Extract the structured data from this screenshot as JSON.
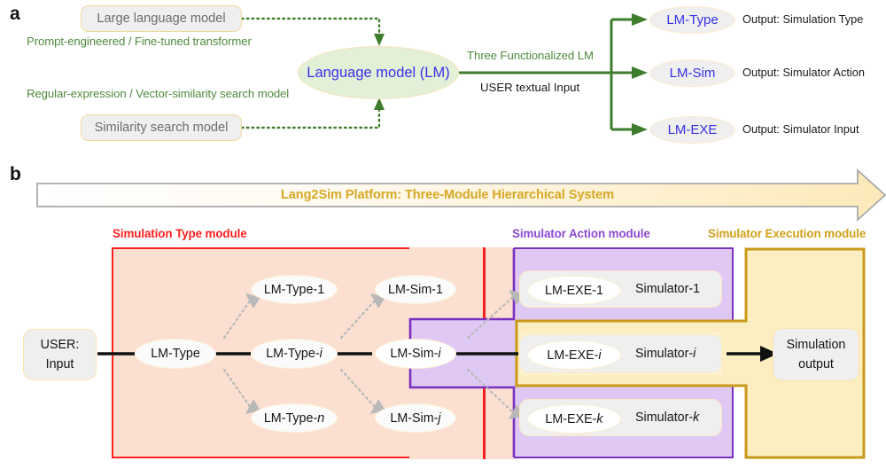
{
  "figure": {
    "panel_a_letter": "a",
    "panel_b_letter": "b"
  },
  "panel_a": {
    "source_boxes": [
      {
        "label": "Large language model"
      },
      {
        "label": "Similarity search model"
      }
    ],
    "annotations": [
      {
        "label": "Prompt-engineered / Fine-tuned transformer",
        "color": "#4f8a3d"
      },
      {
        "label": "Regular-expression / Vector-similarity search model",
        "color": "#4f8a3d"
      }
    ],
    "central_node": {
      "label": "Language model (LM)",
      "fill": "#e3f0d8",
      "text_color": "#3730e8"
    },
    "edge_labels": {
      "above": "Three Functionalized LM",
      "below": "USER textual Input"
    },
    "functionalized": [
      {
        "node": "LM-Type",
        "output": "Output: Simulation Type"
      },
      {
        "node": "LM-Sim",
        "output": "Output: Simulator Action"
      },
      {
        "node": "LM-EXE",
        "output": "Output: Simulator Input"
      }
    ]
  },
  "panel_b": {
    "banner": {
      "label": "Lang2Sim Platform: Three-Module Hierarchical System",
      "text_color": "#d6a824"
    },
    "modules": [
      {
        "name": "Simulation Type module",
        "color": "#ff1f1f",
        "fill": "#fbe0d2"
      },
      {
        "name": "Simulator Action module",
        "color": "#8b4ad0",
        "fill": "#dfc9f4"
      },
      {
        "name": "Simulator Execution module",
        "color": "#d2a017",
        "fill": "#fceec0"
      }
    ],
    "user_input": {
      "line1": "USER:",
      "line2": "Input"
    },
    "type_nodes": {
      "root": "LM-Type",
      "branch_top": "LM-Type-1",
      "branch_mid": "LM-Type-i",
      "branch_bottom": "LM-Type-n"
    },
    "sim_nodes": {
      "top": "LM-Sim-1",
      "mid": "LM-Sim-i",
      "bottom": "LM-Sim-j"
    },
    "exe_rows": [
      {
        "lm": "LM-EXE-1",
        "simulator": "Simulator-1"
      },
      {
        "lm": "LM-EXE-i",
        "simulator": "Simulator-i"
      },
      {
        "lm": "LM-EXE-k",
        "simulator": "Simulator-k"
      }
    ],
    "output_box": {
      "line1": "Simulation",
      "line2": "output"
    }
  }
}
